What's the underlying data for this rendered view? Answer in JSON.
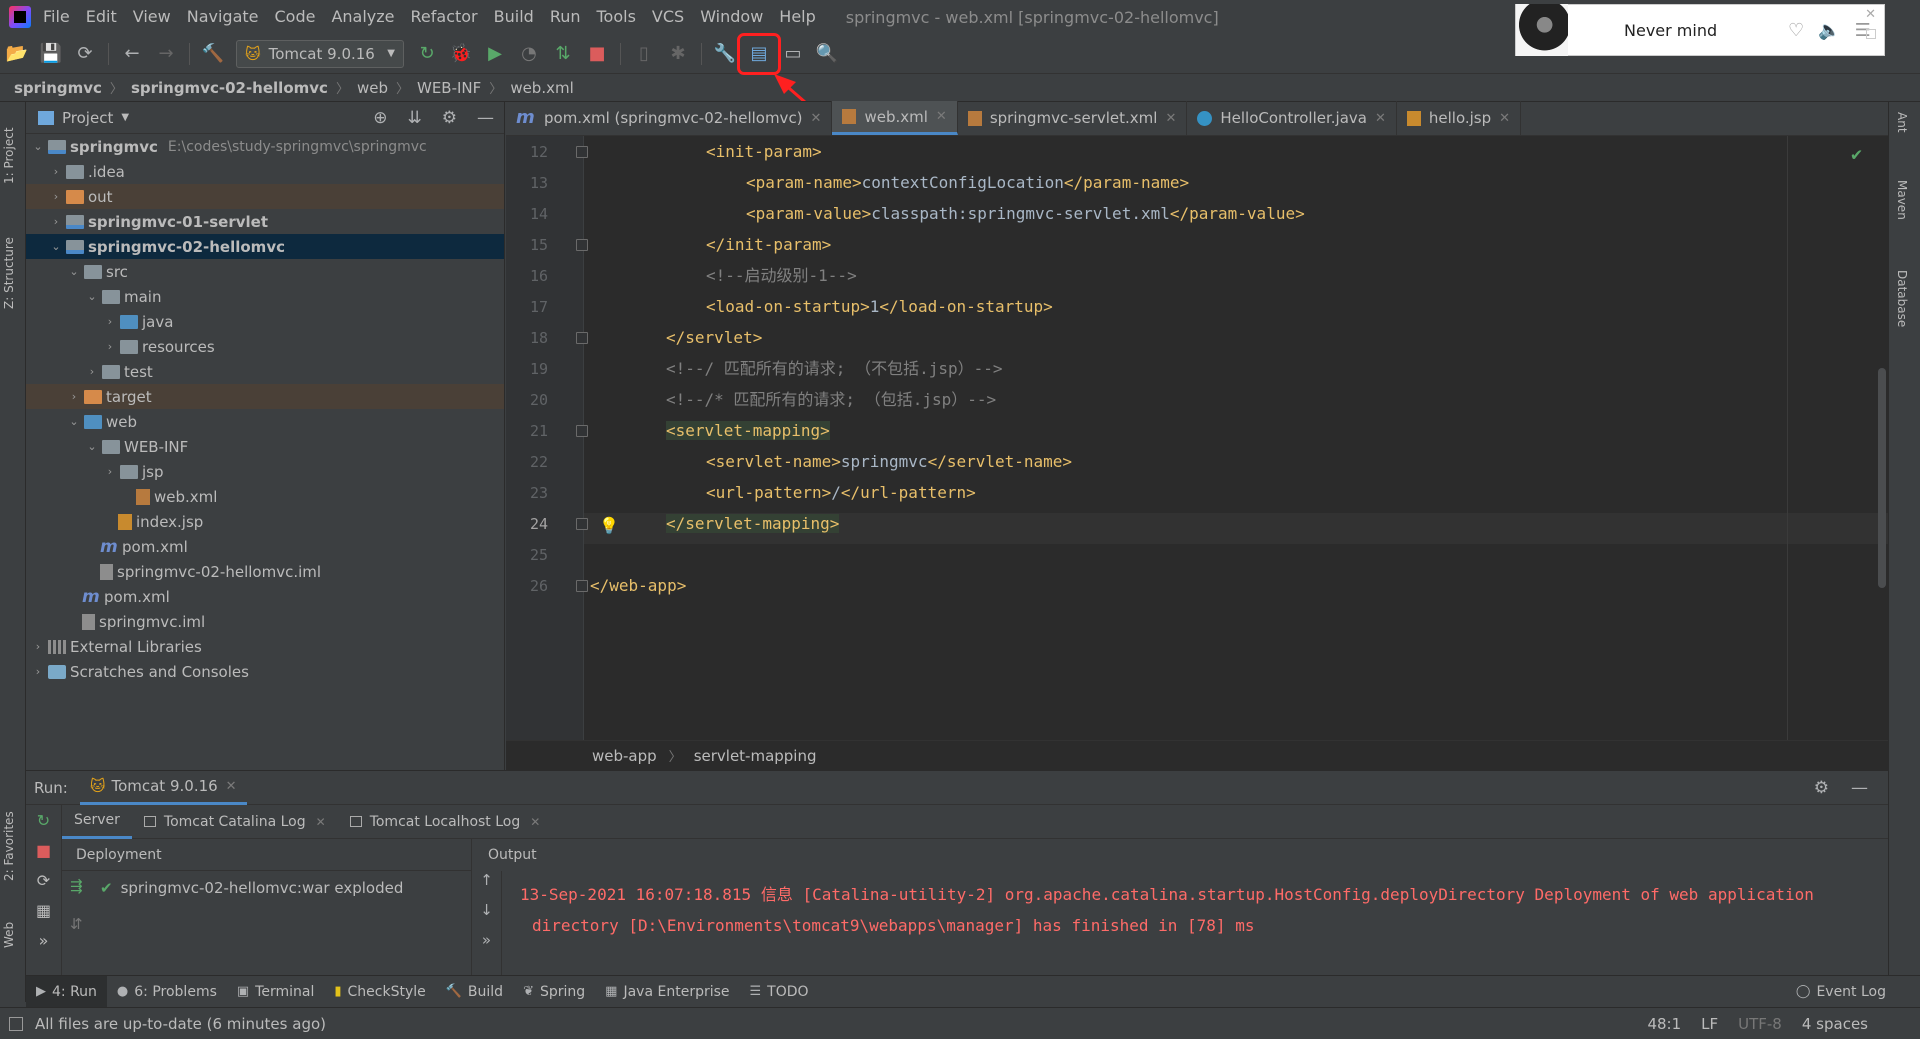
{
  "menubar": {
    "items": [
      "File",
      "Edit",
      "View",
      "Navigate",
      "Code",
      "Analyze",
      "Refactor",
      "Build",
      "Run",
      "Tools",
      "VCS",
      "Window",
      "Help"
    ],
    "window_title": "springmvc - web.xml [springmvc-02-hellomvc]"
  },
  "music_widget": {
    "song": "Never mind"
  },
  "toolbar": {
    "run_config": "Tomcat 9.0.16"
  },
  "breadcrumb": [
    "springmvc",
    "springmvc-02-hellomvc",
    "web",
    "WEB-INF",
    "web.xml"
  ],
  "left_strip": {
    "project_tab": "1: Project",
    "structure_tab": "Z: Structure",
    "favorites_tab": "2: Favorites",
    "web_tab": "Web"
  },
  "project_panel": {
    "title": "Project",
    "tree": [
      {
        "label": "springmvc",
        "sub": "E:\\codes\\study-springmvc\\springmvc"
      },
      {
        "label": ".idea"
      },
      {
        "label": "out"
      },
      {
        "label": "springmvc-01-servlet"
      },
      {
        "label": "springmvc-02-hellomvc"
      },
      {
        "label": "src"
      },
      {
        "label": "main"
      },
      {
        "label": "java"
      },
      {
        "label": "resources"
      },
      {
        "label": "test"
      },
      {
        "label": "target"
      },
      {
        "label": "web"
      },
      {
        "label": "WEB-INF"
      },
      {
        "label": "jsp"
      },
      {
        "label": "web.xml"
      },
      {
        "label": "index.jsp"
      },
      {
        "label": "pom.xml"
      },
      {
        "label": "springmvc-02-hellomvc.iml"
      },
      {
        "label": "pom.xml"
      },
      {
        "label": "springmvc.iml"
      },
      {
        "label": "External Libraries"
      },
      {
        "label": "Scratches and Consoles"
      }
    ]
  },
  "editor_tabs": [
    {
      "label": "pom.xml (springmvc-02-hellomvc)"
    },
    {
      "label": "web.xml"
    },
    {
      "label": "springmvc-servlet.xml"
    },
    {
      "label": "HelloController.java"
    },
    {
      "label": "hello.jsp"
    }
  ],
  "editor": {
    "line_numbers": [
      "12",
      "13",
      "14",
      "15",
      "16",
      "17",
      "18",
      "19",
      "20",
      "21",
      "22",
      "23",
      "24",
      "25",
      "26"
    ],
    "lines": {
      "l12": "<init-param>",
      "l13a": "<param-name>",
      "l13b": "contextConfigLocation",
      "l13c": "</param-name>",
      "l14a": "<param-value>",
      "l14b": "classpath:springmvc-servlet.xml",
      "l14c": "</param-value>",
      "l15": "</init-param>",
      "l16": "<!--启动级别-1-->",
      "l17a": "<load-on-startup>",
      "l17b": "1",
      "l17c": "</load-on-startup>",
      "l18": "</servlet>",
      "l19": "<!--/ 匹配所有的请求; （不包括.jsp）-->",
      "l20": "<!--/* 匹配所有的请求; （包括.jsp）-->",
      "l21": "<servlet-mapping>",
      "l22a": "<servlet-name>",
      "l22b": "springmvc",
      "l22c": "</servlet-name>",
      "l23a": "<url-pattern>",
      "l23b": "/",
      "l23c": "</url-pattern>",
      "l24": "</servlet-mapping>",
      "l26": "</web-app>"
    },
    "breadcrumb": [
      "web-app",
      "servlet-mapping"
    ]
  },
  "right_strip": [
    "Ant",
    "Maven",
    "Database"
  ],
  "run_panel": {
    "label": "Run:",
    "tab": "Tomcat 9.0.16",
    "subtabs": [
      "Server",
      "Tomcat Catalina Log",
      "Tomcat Localhost Log"
    ],
    "deployment_header": "Deployment",
    "deployment_item": "springmvc-02-hellomvc:war exploded",
    "output_header": "Output",
    "output_line1": "13-Sep-2021 16:07:18.815 信息 [Catalina-utility-2] org.apache.catalina.startup.HostConfig.deployDirectory Deployment of web application",
    "output_line2": "directory [D:\\Environments\\tomcat9\\webapps\\manager] has finished in [78] ms"
  },
  "bottom_tabs": [
    "4: Run",
    "6: Problems",
    "Terminal",
    "CheckStyle",
    "Build",
    "Spring",
    "Java Enterprise",
    "TODO"
  ],
  "event_log": "Event Log",
  "statusbar": {
    "message": "All files are up-to-date (6 minutes ago)",
    "position": "48:1",
    "line_sep": "LF",
    "encoding": "UTF-8",
    "indent": "4 spaces"
  },
  "colors": {
    "accent": "#4a88c7",
    "annotation": "#ff2020",
    "error_output": "#ff6b68"
  }
}
